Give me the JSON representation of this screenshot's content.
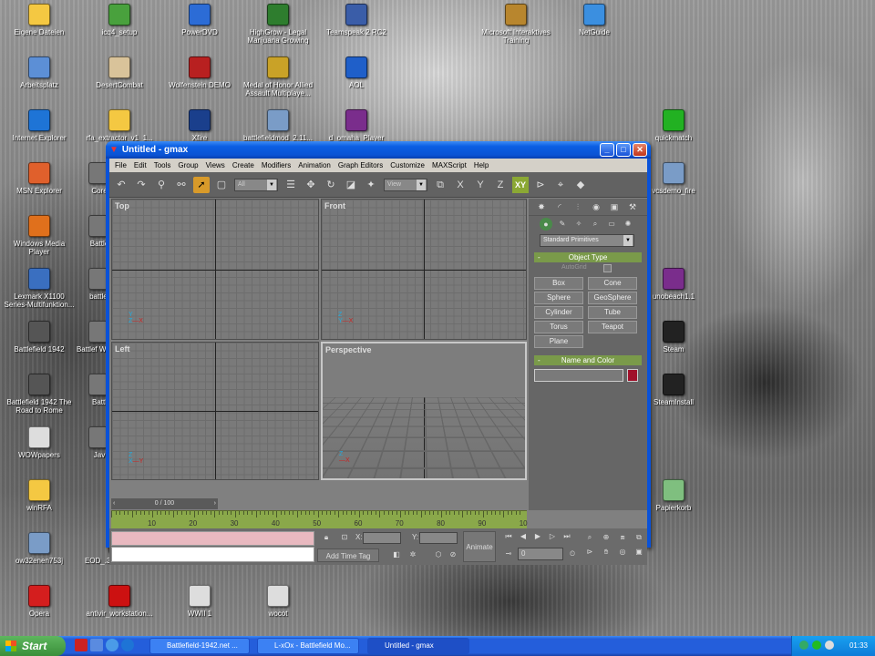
{
  "desktop": {
    "icons": [
      {
        "label": "Eigene Dateien",
        "icon": "folder-icon",
        "color": "#f4c842"
      },
      {
        "label": "icq4_setup",
        "icon": "flower-icon",
        "color": "#49a13d"
      },
      {
        "label": "PowerDVD",
        "icon": "disc-icon",
        "color": "#2c6cd6"
      },
      {
        "label": "HighGrow - Legal Marijuana Growing",
        "icon": "leaf-icon",
        "color": "#2e7d2e"
      },
      {
        "label": "Teamspeak 2 RC2",
        "icon": "ts-icon",
        "color": "#3a5da8"
      },
      {
        "label": "Microsoft Interaktives Training",
        "icon": "book-icon",
        "color": "#b8862e"
      },
      {
        "label": "NetGuide",
        "icon": "window-icon",
        "color": "#3b8fe0"
      },
      {
        "label": "Arbeitsplatz",
        "icon": "computer-icon",
        "color": "#5c8fd6"
      },
      {
        "label": "DesertCombat",
        "icon": "gun-icon",
        "color": "#d9c39a"
      },
      {
        "label": "Wolfenstein DEMO",
        "icon": "eagle-icon",
        "color": "#b82020"
      },
      {
        "label": "Medal of Honor Allied Assault Multiplaye...",
        "icon": "medal-icon",
        "color": "#c9a227"
      },
      {
        "label": "AOL",
        "icon": "aol-icon",
        "color": "#1f5fc9"
      },
      {
        "label": "Internet Explorer",
        "icon": "ie-icon",
        "color": "#1e74d6"
      },
      {
        "label": "rfa_extractor_v1_1...",
        "icon": "folder-icon",
        "color": "#f4c842"
      },
      {
        "label": "Xfire",
        "icon": "xfire-icon",
        "color": "#1a3f8c"
      },
      {
        "label": "battlefieldmod_2.11...",
        "icon": "installer-icon",
        "color": "#7a9cc7"
      },
      {
        "label": "d_omaha_Player",
        "icon": "rar-icon",
        "color": "#7a2d8c"
      },
      {
        "label": "quickmatch",
        "icon": "quickmatch-icon",
        "color": "#22b122"
      },
      {
        "label": "MSN Explorer",
        "icon": "butterfly-icon",
        "color": "#e0602c"
      },
      {
        "label": "Core",
        "icon": "app-icon",
        "color": "#777777"
      },
      {
        "label": "vcsdemo_fire",
        "icon": "installer-icon",
        "color": "#7a9cc7"
      },
      {
        "label": "Windows Media Player",
        "icon": "play-icon",
        "color": "#e0701c"
      },
      {
        "label": "Battle",
        "icon": "app-icon",
        "color": "#777777"
      },
      {
        "label": "Lexmark X1100 Series-Multifunktion...",
        "icon": "printer-icon",
        "color": "#3a6fc0"
      },
      {
        "label": "battlef",
        "icon": "app-icon",
        "color": "#777777"
      },
      {
        "label": "unobeach1.1",
        "icon": "rar-icon",
        "color": "#7a2d8c"
      },
      {
        "label": "Battlefield 1942",
        "icon": "bf-icon",
        "color": "#555555"
      },
      {
        "label": "Battlef Weapo",
        "icon": "app-icon",
        "color": "#777777"
      },
      {
        "label": "Steam",
        "icon": "steam-icon",
        "color": "#222222"
      },
      {
        "label": "Battlefield 1942 The Road to Rome",
        "icon": "bf-icon",
        "color": "#555555"
      },
      {
        "label": "Battl",
        "icon": "app-icon",
        "color": "#777777"
      },
      {
        "label": "SteamInstall",
        "icon": "steam-icon",
        "color": "#222222"
      },
      {
        "label": "WOWpapers",
        "icon": "doc-icon",
        "color": "#dddddd"
      },
      {
        "label": "Jav",
        "icon": "app-icon",
        "color": "#777777"
      },
      {
        "label": "winRFA",
        "icon": "folder-icon",
        "color": "#f4c842"
      },
      {
        "label": "Papierkorb",
        "icon": "recycle-bin-icon",
        "color": "#7fbf7f"
      },
      {
        "label": "ow32enen753j",
        "icon": "installer-icon",
        "color": "#7a9cc7"
      },
      {
        "label": "EOD_.31_patch_final",
        "icon": "app-icon",
        "color": "#777777"
      },
      {
        "label": "SuddenStrike",
        "icon": "app-icon",
        "color": "#777777"
      },
      {
        "label": "wrar330",
        "icon": "app-icon",
        "color": "#777777"
      },
      {
        "label": "Opera",
        "icon": "opera-icon",
        "color": "#d41e1e"
      },
      {
        "label": "antivir_workstation...",
        "icon": "antivir-icon",
        "color": "#cc1111"
      },
      {
        "label": "WWII 1",
        "icon": "doc-icon",
        "color": "#dddddd"
      },
      {
        "label": "wocot",
        "icon": "doc-icon",
        "color": "#dddddd"
      }
    ]
  },
  "window": {
    "title": "Untitled - gmax",
    "menu": [
      "File",
      "Edit",
      "Tools",
      "Group",
      "Views",
      "Create",
      "Modifiers",
      "Animation",
      "Graph Editors",
      "Customize",
      "MAXScript",
      "Help"
    ],
    "toolbar": {
      "selection_filter": "All",
      "ref_coord": "View",
      "axis_x": "X",
      "axis_y": "Y",
      "axis_z": "Z",
      "axis_xy": "XY"
    },
    "viewports": {
      "top": "Top",
      "front": "Front",
      "left": "Left",
      "perspective": "Perspective"
    },
    "command_panel": {
      "category": "Standard Primitives",
      "object_type_header": "Object Type",
      "autogrid": "AutoGrid",
      "buttons": [
        "Box",
        "Cone",
        "Sphere",
        "GeoSphere",
        "Cylinder",
        "Tube",
        "Torus",
        "Teapot",
        "Plane"
      ],
      "name_color_header": "Name and Color",
      "object_color": "#a0102a"
    },
    "time": {
      "slider": "0 / 100",
      "ticks": [
        "10",
        "20",
        "30",
        "40",
        "50",
        "60",
        "70",
        "80",
        "90",
        "10"
      ],
      "x_label": "X:",
      "y_label": "Y:",
      "add_time_tag": "Add Time Tag",
      "animate": "Animate",
      "frame": "0"
    }
  },
  "taskbar": {
    "start": "Start",
    "tasks": [
      "Battlefield-1942.net ...",
      "L-xOx - Battlefield Mo...",
      "Untitled - gmax"
    ],
    "clock": "01:33"
  }
}
